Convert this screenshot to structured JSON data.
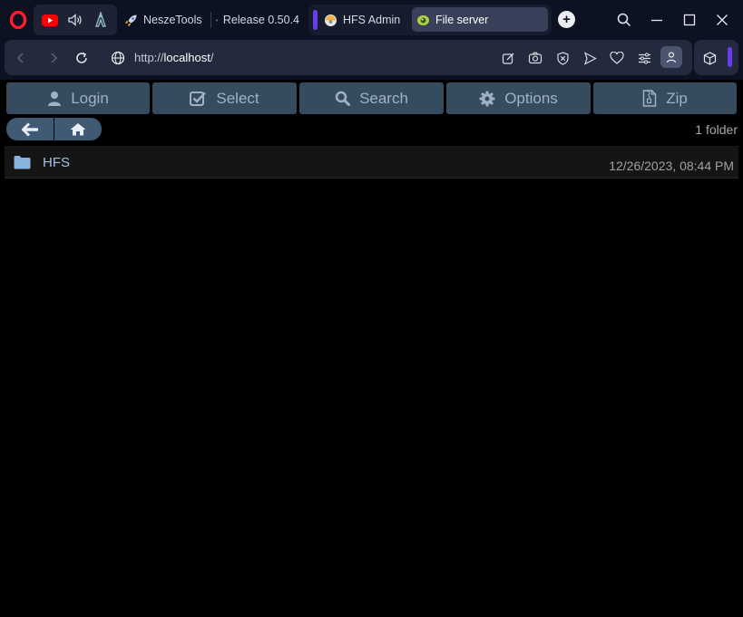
{
  "browser": {
    "tabs": [
      {
        "label": "NeszeTools",
        "icon": "rocket-icon"
      },
      {
        "label": "Release 0.50.4",
        "icon": "github-icon"
      },
      {
        "label": "HFS Admin",
        "icon": "hfs-icon"
      },
      {
        "label": "File server",
        "icon": "hfs-eye-icon",
        "active": true
      }
    ],
    "address": {
      "prefix": "http://",
      "host": "localhost",
      "path": "/"
    },
    "accent": "#6a3cf0"
  },
  "toolbar": {
    "login_label": "Login",
    "select_label": "Select",
    "search_label": "Search",
    "options_label": "Options",
    "zip_label": "Zip"
  },
  "listing": {
    "summary": "1 folder",
    "items": [
      {
        "name": "HFS",
        "type": "folder",
        "modified": "12/26/2023, 08:44 PM"
      }
    ]
  }
}
